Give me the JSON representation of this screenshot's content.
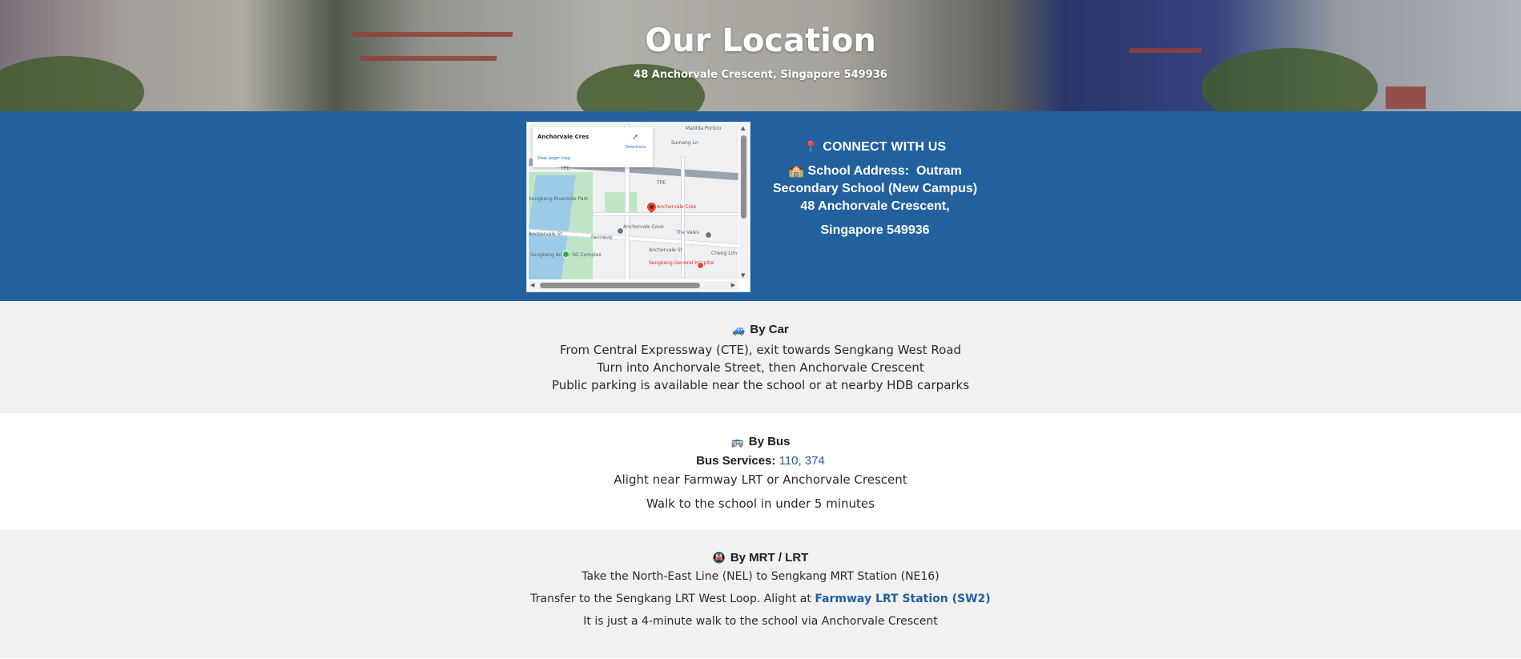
{
  "hero": {
    "title": "Our Location",
    "subtitle": "48 Anchorvale Crescent, Singapore 549936"
  },
  "map": {
    "place_name": "Anchorvale Cres",
    "view_larger": "View larger map",
    "directions": "Directions",
    "pin_label": "Anchorvale Cres",
    "labels": {
      "matilda": "Matilda Portico",
      "sumang": "Sumang Ln",
      "tpe_1": "TPE",
      "tpe_2": "TPE",
      "sengkang_park": "Sengkang Riverside Park",
      "anchorvale_st": "Anchorvale St",
      "anchorvale_st_2": "Anchorvale St",
      "fernvale": "Farmway",
      "anchorvale_cove": "Anchorvale Cove",
      "the_vales": "The Vales",
      "cheng_lim": "Cheng Lim",
      "active_sg": "Sengkang Active SG Complex",
      "hospital": "Sengkang General Hospital"
    }
  },
  "connect": {
    "heading": "CONNECT WITH US",
    "pin_icon": "📍",
    "school_icon": "🏫",
    "address_label": "School Address:",
    "school_name_1": "Outram",
    "school_name_2": "Secondary School (New Campus)",
    "street": "48 Anchorvale Crescent,",
    "postal": "Singapore 549936"
  },
  "car": {
    "icon": "🚙",
    "title": "By Car",
    "lines": [
      "From Central Expressway (CTE), exit towards Sengkang West Road",
      "Turn into Anchorvale Street, then Anchorvale Crescent",
      "Public parking is available near the school or at nearby HDB carparks"
    ]
  },
  "bus": {
    "icon": "🚌",
    "title": "By Bus",
    "services_label": "Bus Services:",
    "services": "110, 374",
    "lines": [
      "Alight near Farmway LRT or Anchorvale Crescent",
      "Walk to the school in under 5 minutes"
    ]
  },
  "mrt": {
    "icon": "🚇",
    "title": "By MRT / LRT",
    "line1": "Take the North-East Line (NEL) to Sengkang MRT Station (NE16)",
    "line2_prefix": "Transfer to the Sengkang LRT West Loop. Alight at",
    "line2_link": "Farmway LRT Station (SW2)",
    "line3": "It is just a 4-minute walk to the school via Anchorvale Crescent"
  },
  "colors": {
    "band_blue": "#22609e",
    "section_grey": "#f1f1f1",
    "link_blue": "#22609e"
  }
}
